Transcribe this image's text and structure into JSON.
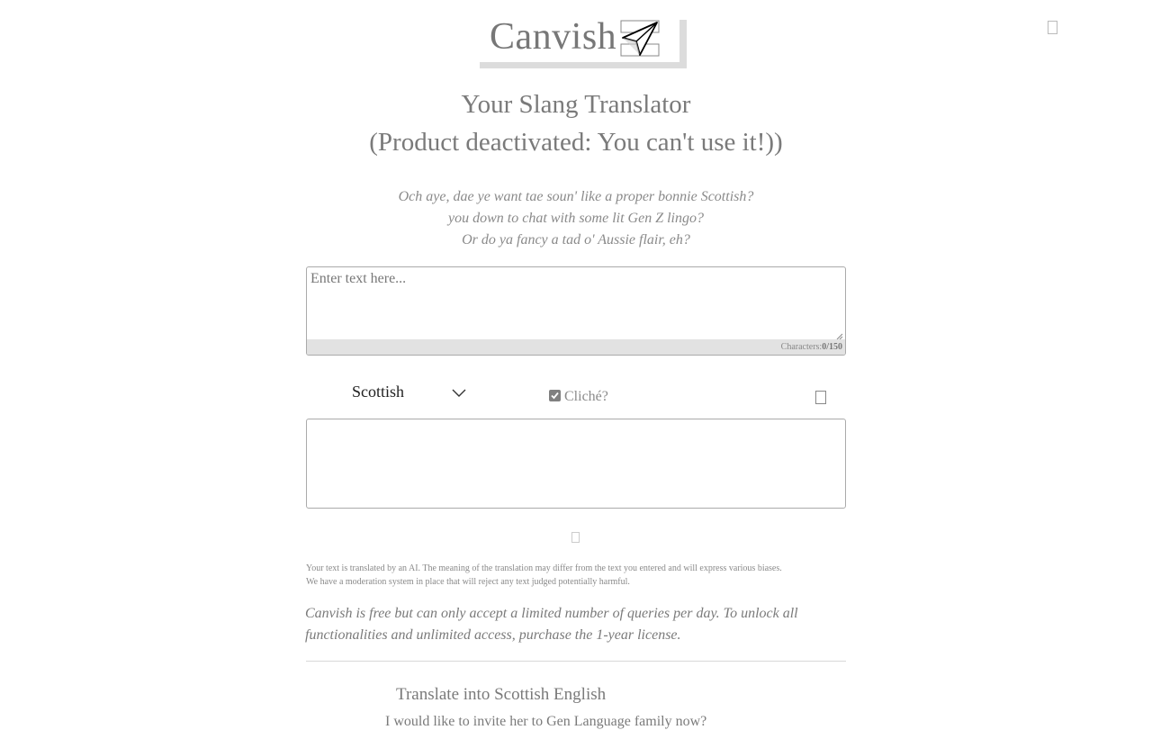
{
  "header": {
    "logo_text": "Canvish"
  },
  "title": {
    "line1": "Your Slang Translator",
    "line2": "(Product deactivated: You can't use it!))"
  },
  "intro": {
    "line1": "Och aye, dae ye want tae soun' like a proper bonnie Scottish?",
    "line2": "you down to chat with some lit Gen Z lingo?",
    "line3": "Or do ya fancy a tad o' Aussie flair, eh?"
  },
  "input": {
    "placeholder": "Enter text here...",
    "value": "",
    "counter_label": "Characters:",
    "counter_value": "0/150"
  },
  "controls": {
    "language_selected": "Scottish",
    "cliche_label": "Cliché?",
    "cliche_checked": true
  },
  "output": {
    "value": ""
  },
  "disclaimer": {
    "line1": "Your text is translated by an AI. The meaning of the translation may differ from the text you entered and will express various biases.",
    "line2": "We have a moderation system in place that will reject any text judged potentially harmful."
  },
  "license_note": "Canvish is free but can only accept a limited number of queries per day. To unlock all functionalities and unlimited access, purchase the 1-year license.",
  "faq": {
    "title": "Translate into Scottish English",
    "subtitle": "I would like to invite her to Gen Language family now?"
  }
}
